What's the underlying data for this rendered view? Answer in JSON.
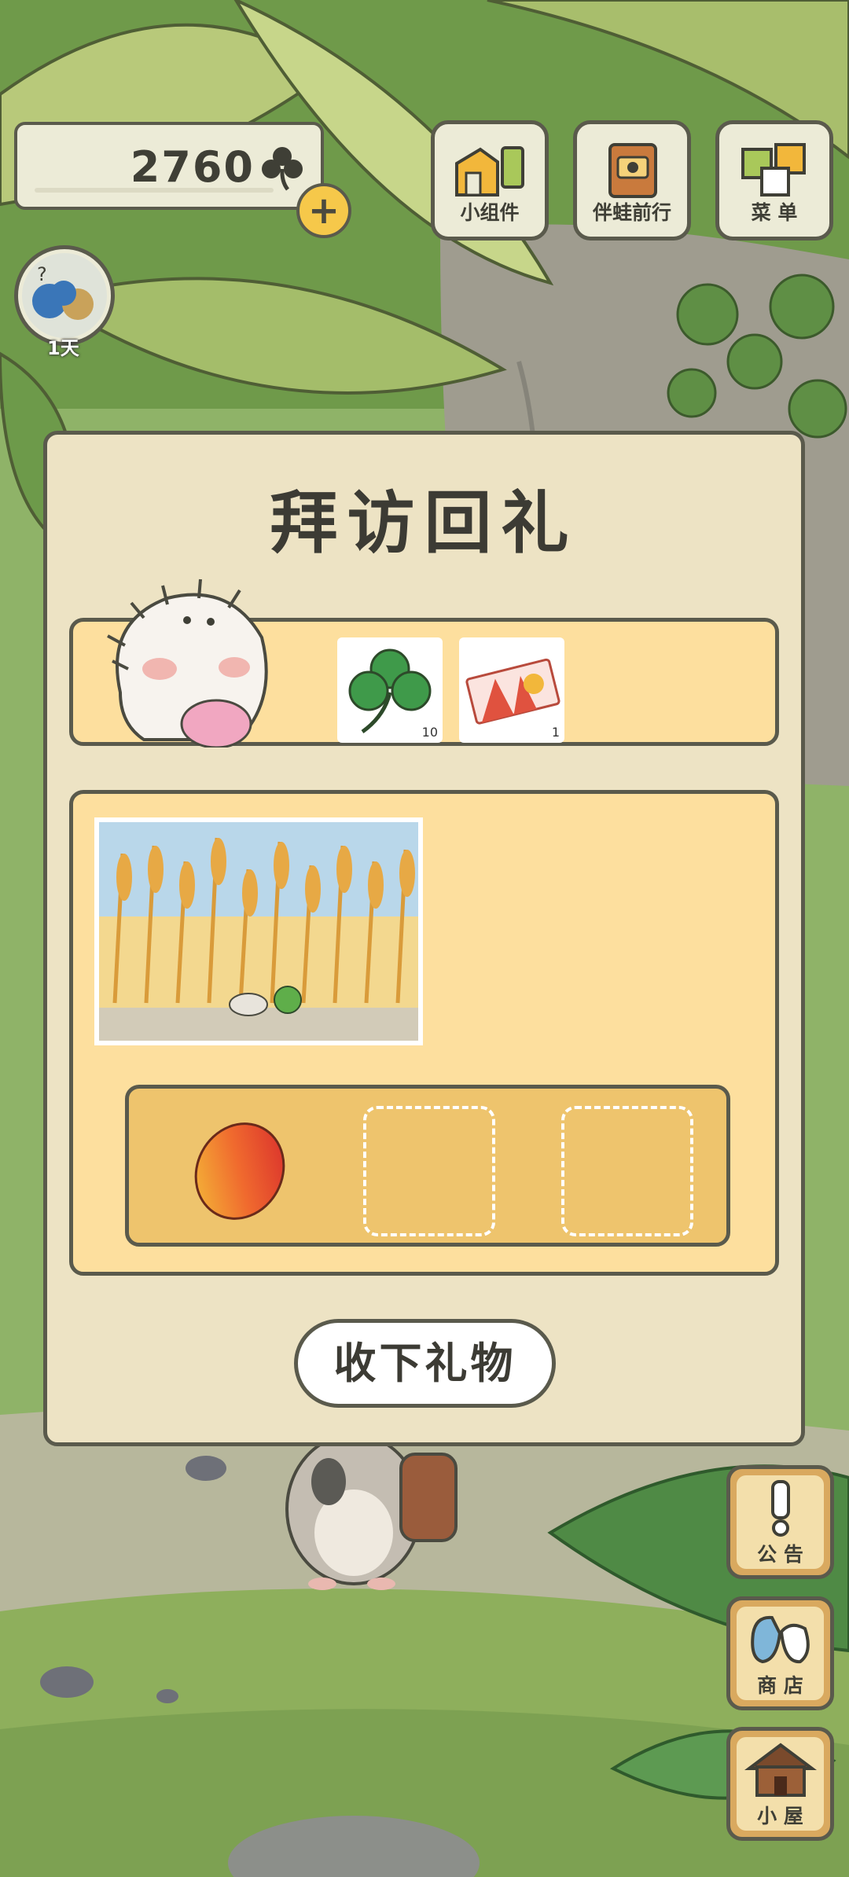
{
  "hud": {
    "clover_count": "2760",
    "day_label": "1天"
  },
  "top_buttons": [
    {
      "label": "小组件",
      "icon": "widget-icon"
    },
    {
      "label": "伴蛙前行",
      "icon": "journal-icon"
    },
    {
      "label": "菜 单",
      "icon": "menu-icon"
    }
  ],
  "modal": {
    "title": "拜访回礼",
    "reward_items": [
      {
        "name": "clover-icon",
        "qty": "10"
      },
      {
        "name": "ticket-icon",
        "qty": "1"
      }
    ],
    "gift_slots": [
      {
        "filled": true,
        "item": "mango-icon"
      },
      {
        "filled": false
      },
      {
        "filled": false
      }
    ],
    "accept_label": "收下礼物"
  },
  "side_buttons": [
    {
      "label": "公 告",
      "icon": "exclamation-icon"
    },
    {
      "label": "商 店",
      "icon": "shop-bag-icon"
    },
    {
      "label": "小 屋",
      "icon": "house-icon"
    }
  ],
  "colors": {
    "panel_bg": "#ede3c4",
    "panel_inner": "#fddf9e",
    "slot_tray": "#eec46d",
    "outline": "#5a5a4c",
    "accent_yellow": "#f6c84a"
  }
}
